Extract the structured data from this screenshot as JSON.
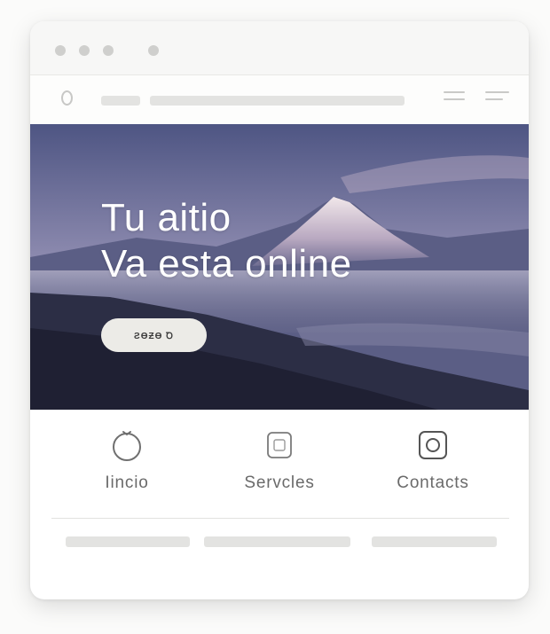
{
  "hero": {
    "title_line1": "Tu aitio",
    "title_line2": "Va esta online",
    "button_label": "ƧƟƵƟ Ꝺ"
  },
  "nav_items": [
    {
      "label": "Iincio",
      "icon": "circle-icon"
    },
    {
      "label": "Servcles",
      "icon": "square-icon"
    },
    {
      "label": "Contacts",
      "icon": "camera-icon"
    }
  ],
  "colors": {
    "page_background": "#fbfbfa",
    "window_background": "#ffffff",
    "placeholder_bar": "#e3e3e1",
    "hero_sky_top": "#4e5583",
    "hero_sky_bottom": "#c7b1c7",
    "button_background": "#ecebe7",
    "nav_text": "#6a6a6a"
  }
}
